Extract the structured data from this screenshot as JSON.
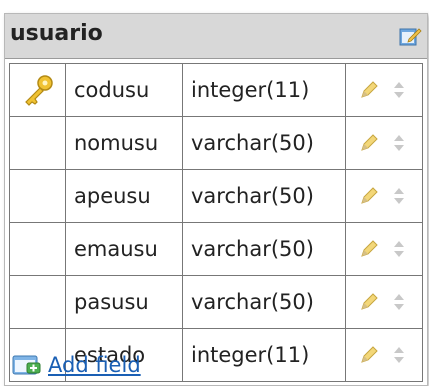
{
  "table": {
    "name": "usuario",
    "header_icon": "edit-table-icon",
    "fields": [
      {
        "name": "codusu",
        "type": "integer(11)",
        "primary_key": true
      },
      {
        "name": "nomusu",
        "type": "varchar(50)",
        "primary_key": false
      },
      {
        "name": "apeusu",
        "type": "varchar(50)",
        "primary_key": false
      },
      {
        "name": "emausu",
        "type": "varchar(50)",
        "primary_key": false
      },
      {
        "name": "pasusu",
        "type": "varchar(50)",
        "primary_key": false
      },
      {
        "name": "estado",
        "type": "integer(11)",
        "primary_key": false
      }
    ],
    "add_field_label": "Add field"
  }
}
